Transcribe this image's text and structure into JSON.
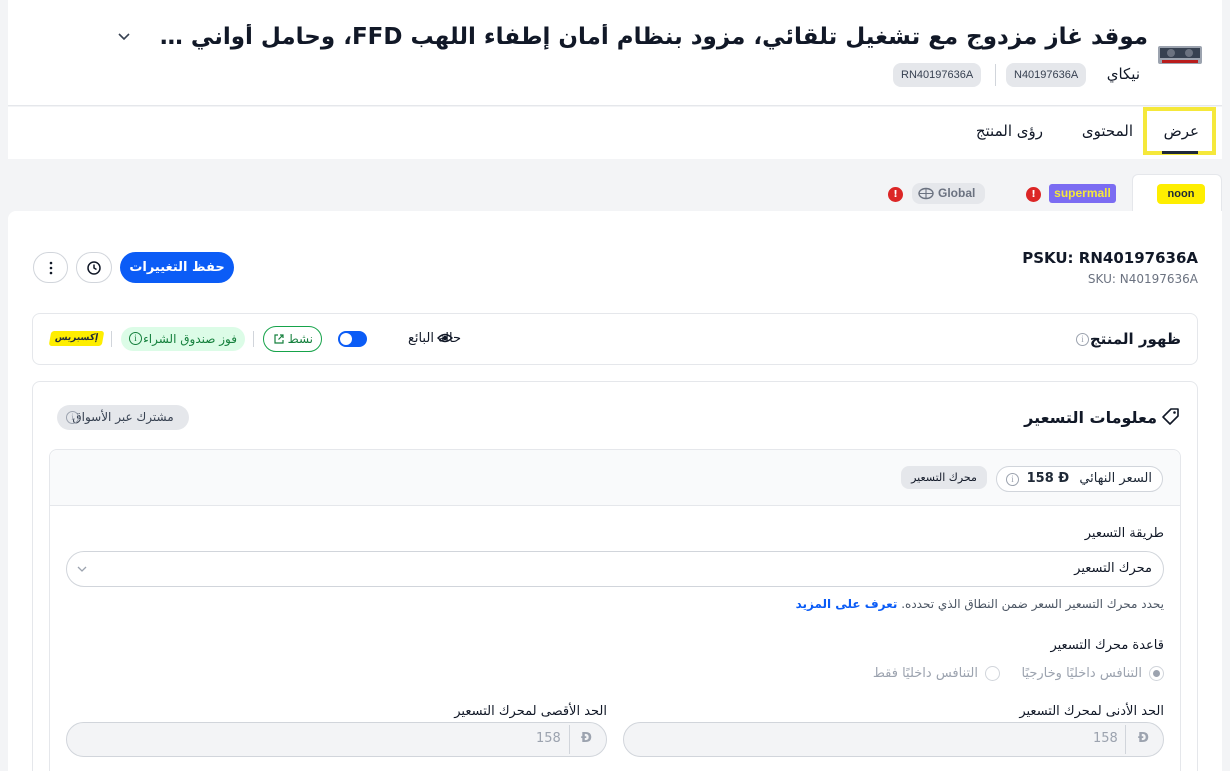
{
  "header": {
    "title": "موقد غاز مزدوج مع تشغيل تلقائي، مزود بنظام أمان إطفاء اللهب FFD، وحامل أواني مربع مطلي با...",
    "brand": "نيكاي",
    "ids": [
      "N40197636A",
      "RN40197636A"
    ]
  },
  "tabs": [
    {
      "label": "عرض",
      "active": true
    },
    {
      "label": "المحتوى",
      "active": false
    },
    {
      "label": "رؤى المنتج",
      "active": false
    }
  ],
  "marketplaces": {
    "noon": "noon",
    "supermall": "supermall",
    "global": "Global",
    "warning": "!"
  },
  "skus": {
    "psku": "PSKU: RN40197636A",
    "sku": "SKU: N40197636A"
  },
  "actions": {
    "save_label": "حفظ التغييرات",
    "history_icon": "history-icon",
    "more_icon": "more-vertical-icon"
  },
  "visibility": {
    "title": "ظهور المنتج",
    "seller_status_label": "حالة البائع",
    "seller_status_on": true,
    "active_label": "نشط",
    "buybox_label": "فوز صندوق الشراء",
    "express_label": "إكسبريس"
  },
  "pricing": {
    "title": "معلومات التسعير",
    "shared_label": "مشترك عبر الأسواق",
    "final_price_label": "السعر النهائي",
    "final_price_value": "158",
    "currency_symbol": "Ð",
    "engine_chip": "محرك التسعير",
    "method_label": "طريقة التسعير",
    "method_value": "محرك التسعير",
    "helper_text": "يحدد محرك التسعير السعر ضمن النطاق الذي تحدده.",
    "helper_link": "تعرف على المزيد",
    "rule_label": "قاعدة محرك التسعير",
    "rule_options": [
      {
        "label": "التنافس داخليًا وخارجيًا",
        "selected": true
      },
      {
        "label": "التنافس داخليًا فقط",
        "selected": false
      }
    ],
    "min_label": "الحد الأدنى لمحرك التسعير",
    "min_value": "158",
    "max_label": "الحد الأقصى لمحرك التسعير",
    "max_value": "158"
  },
  "colors": {
    "primary": "#0b5cf6",
    "highlight": "#f5e83a",
    "noon_yellow": "#feee00",
    "supermall_purple": "#7b6cf2",
    "success": "#16a34a",
    "danger": "#dc2626"
  }
}
